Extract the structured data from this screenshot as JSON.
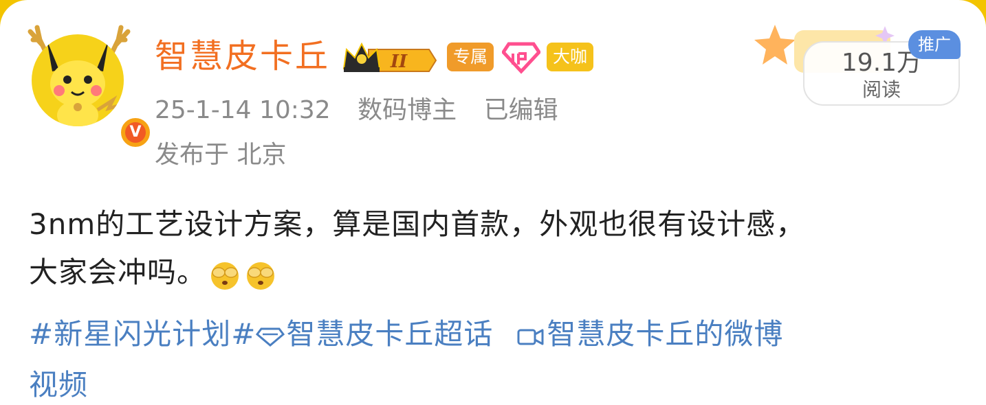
{
  "post": {
    "username": "智慧皮卡丘",
    "crown_level": "II",
    "tag_exclusive": "专属",
    "tag_big": "大咖",
    "date": "25-1-14 10:32",
    "category": "数码博主",
    "edited": "已编辑",
    "location": "发布于 北京",
    "reads": {
      "count": "19.1万",
      "label": "阅读"
    },
    "promo_label": "推广",
    "text_line1": "3nm的工艺设计方案，算是国内首款，外观也很有设计感，",
    "text_line2": "大家会冲吗。",
    "hashtag": "#新星闪光计划#",
    "super_topic": "智慧皮卡丘超话",
    "video_link_a": "智慧皮卡丘的微博",
    "video_link_b": "视频"
  },
  "colors": {
    "username": "#f26f21",
    "link": "#4a7fc1",
    "meta": "#8a8a8a",
    "frame": "#f3c400"
  }
}
